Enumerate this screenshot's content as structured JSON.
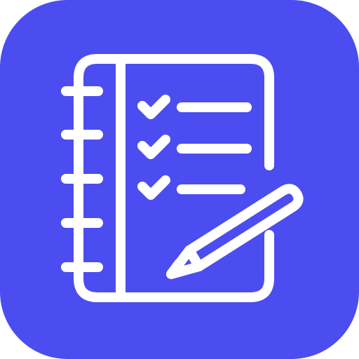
{
  "icon": {
    "name": "notebook-checklist-pencil-icon",
    "background_color": "#4B4DF0",
    "glyph_color": "#FFFFFF",
    "checklist_items_checked": [
      true,
      true,
      true
    ],
    "spiral_rings": 5
  }
}
